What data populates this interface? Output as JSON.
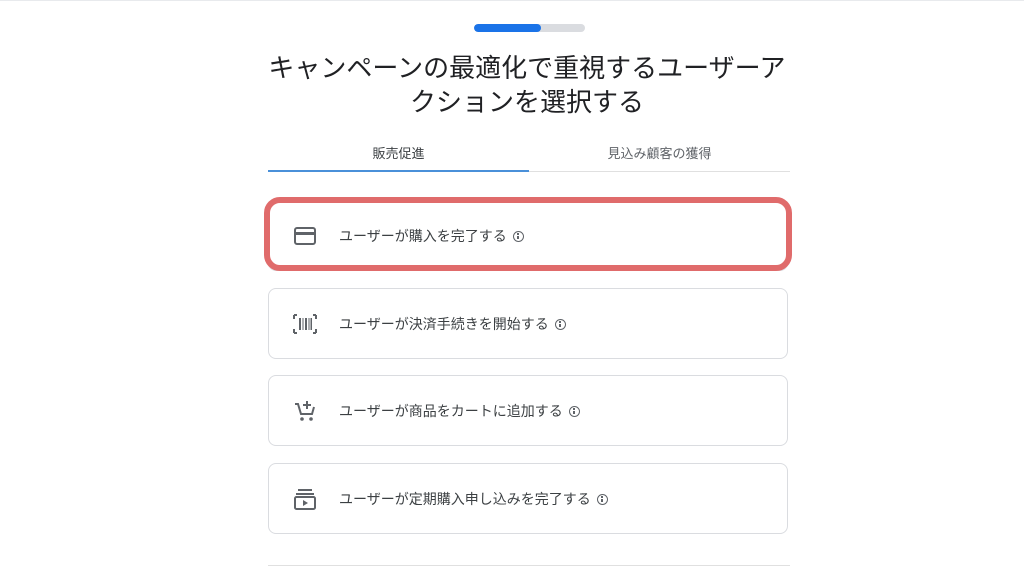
{
  "progress": {
    "value": 0.6
  },
  "title": "キャンペーンの最適化で重視するユーザーアクションを選択する",
  "tabs": [
    {
      "label": "販売促進",
      "active": true
    },
    {
      "label": "見込み顧客の獲得",
      "active": false
    }
  ],
  "options": [
    {
      "label": "ユーザーが購入を完了する",
      "icon": "credit-card-icon",
      "highlighted": true
    },
    {
      "label": "ユーザーが決済手続きを開始する",
      "icon": "barcode-icon",
      "highlighted": false
    },
    {
      "label": "ユーザーが商品をカートに追加する",
      "icon": "add-to-cart-icon",
      "highlighted": false
    },
    {
      "label": "ユーザーが定期購入申し込みを完了する",
      "icon": "subscriptions-icon",
      "highlighted": false
    }
  ],
  "colors": {
    "accent": "#1a73e8",
    "highlight": "#e06b6b",
    "icon": "#5f6368"
  }
}
